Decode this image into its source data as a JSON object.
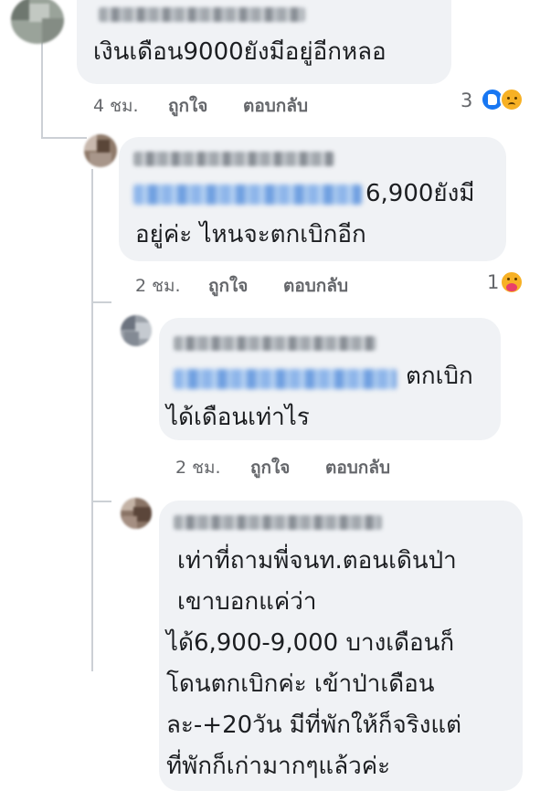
{
  "comments": [
    {
      "text_lines": [
        "เงินเดือน9000ยังมีอยู่อีกหลอ"
      ],
      "time": "4 ชม.",
      "like_label": "ถูกใจ",
      "reply_label": "ตอบกลับ",
      "reaction_count": "3",
      "reactions": [
        "like-icon",
        "sad-icon"
      ]
    },
    {
      "text_lines": [
        "6,900ยังมี",
        "อยู่ค่ะ ไหนจะตกเบิกอีก"
      ],
      "time": "2 ชม.",
      "like_label": "ถูกใจ",
      "reply_label": "ตอบกลับ",
      "reaction_count": "1",
      "reactions": [
        "care-icon"
      ]
    },
    {
      "text_lines": [
        "ตกเบิก",
        "ได้เดือนเท่าไร"
      ],
      "time": "2 ชม.",
      "like_label": "ถูกใจ",
      "reply_label": "ตอบกลับ"
    },
    {
      "text_lines": [
        "เท่าที่ถามพี่จนท.ตอนเดินป่า",
        "เขาบอกแค่ว่า",
        "ได้6,900-9,000 บางเดือนก็",
        "โดนตกเบิกค่ะ เข้าป่าเดือน",
        "ละ-+20วัน มีที่พักให้ก็จริงแต่",
        "ที่พักก็เก่ามากๆแล้วค่ะ"
      ]
    }
  ],
  "colors": {
    "bubble": "#f0f2f5",
    "meta_text": "#65676b",
    "like_blue": "#1877f2"
  }
}
